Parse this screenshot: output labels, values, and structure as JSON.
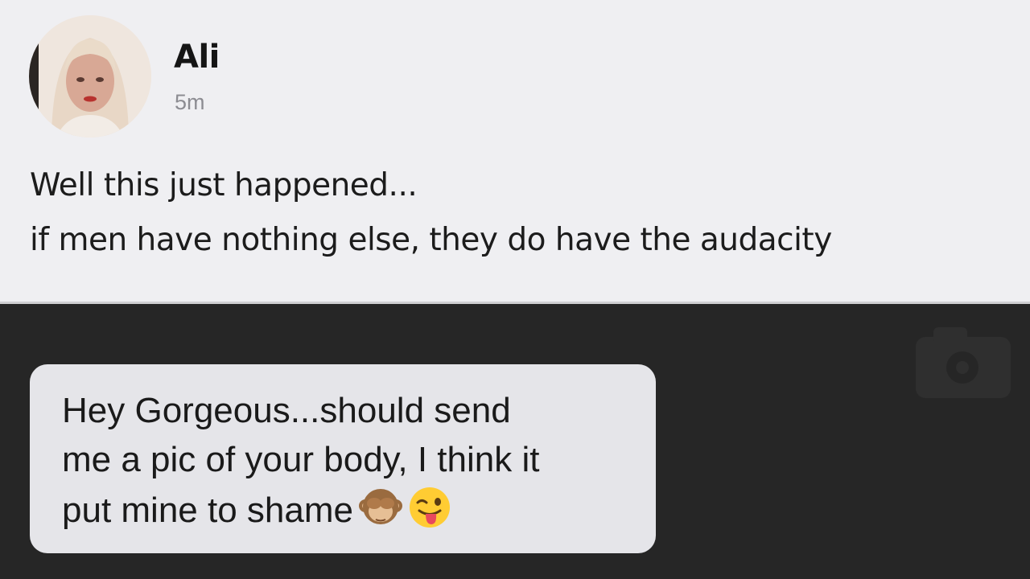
{
  "post": {
    "author": "Ali",
    "time": "5m",
    "lines": [
      "Well this just happened...",
      "if men have nothing else, they do have the audacity"
    ]
  },
  "message": {
    "lines": [
      "Hey Gorgeous...should send",
      "me a pic of your body, I think it",
      "put mine to shame"
    ],
    "emoji": [
      "see-no-evil-monkey-icon",
      "winking-face-with-tongue-icon"
    ]
  },
  "colors": {
    "post_background": "#efeff2",
    "chat_background": "#262626",
    "bubble_background": "#e5e5e9"
  }
}
